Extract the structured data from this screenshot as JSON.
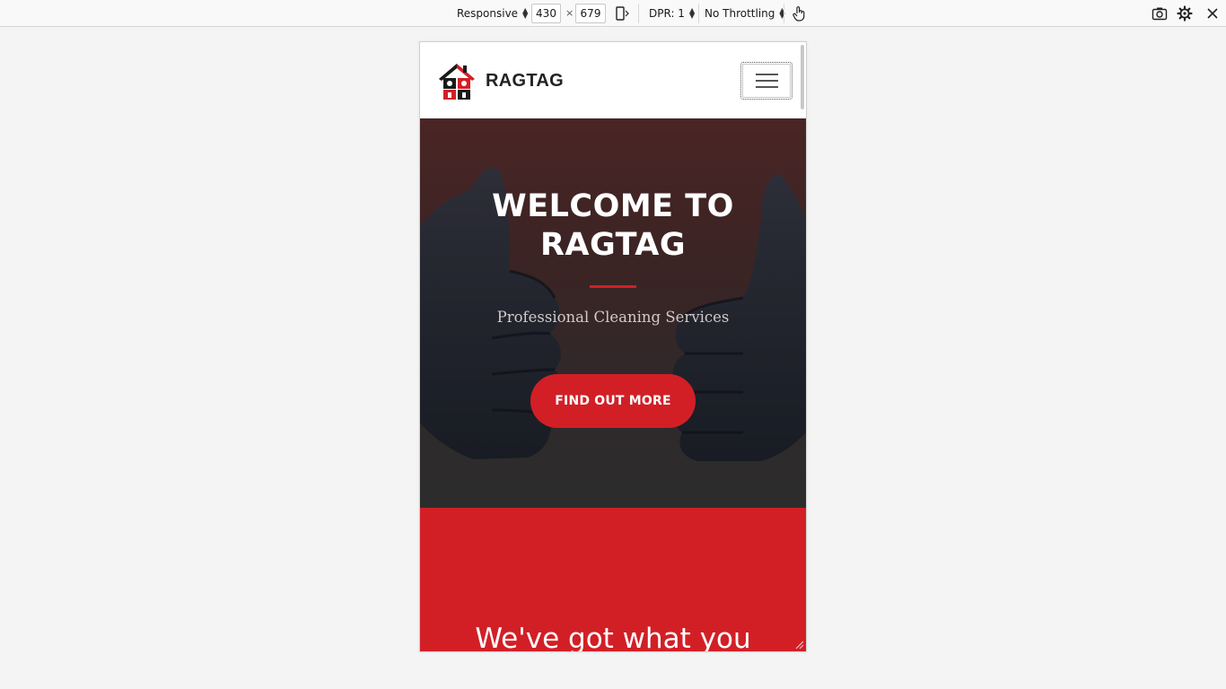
{
  "devtools": {
    "device_mode": "Responsive",
    "width": "430",
    "times": "×",
    "height": "679",
    "dpr": "DPR: 1",
    "throttling": "No Throttling",
    "icons": [
      "rotate-device-icon",
      "touch-simulation-icon",
      "screenshot-icon",
      "settings-icon",
      "close-icon"
    ]
  },
  "site": {
    "brand": "RAGTAG",
    "hero": {
      "title_line1": "WELCOME TO",
      "title_line2": "RAGTAG",
      "subtitle": "Professional Cleaning Services",
      "cta": "FIND OUT MORE"
    },
    "section": {
      "heading": "We've got what you"
    }
  },
  "colors": {
    "accent": "#d21f26",
    "hero_dark": "#3a2424",
    "text_dark": "#222222"
  }
}
